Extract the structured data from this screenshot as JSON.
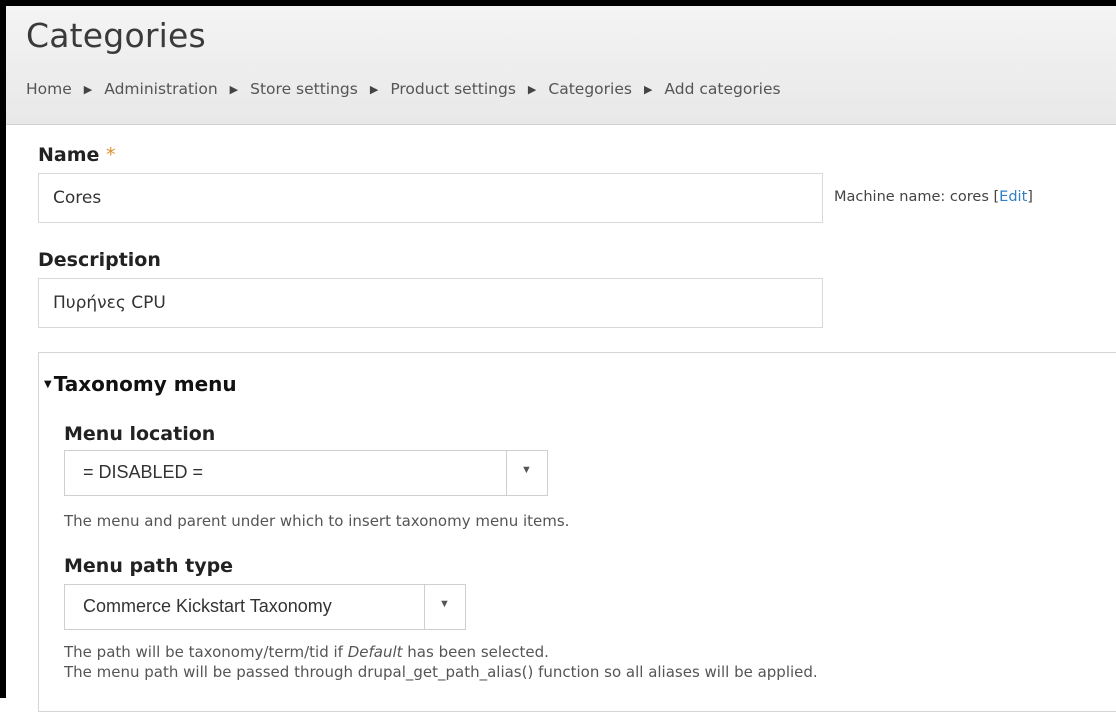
{
  "header": {
    "title": "Categories",
    "breadcrumbs": [
      "Home",
      "Administration",
      "Store settings",
      "Product settings",
      "Categories",
      "Add categories"
    ],
    "separator": "▶"
  },
  "form": {
    "name": {
      "label": "Name",
      "required_marker": "*",
      "value": "Cores",
      "machine_name_prefix": "Machine name: cores",
      "machine_name_edit": "Edit"
    },
    "description": {
      "label": "Description",
      "value": "Πυρήνες CPU"
    },
    "taxonomy_menu": {
      "legend": "Taxonomy menu",
      "collapse_icon": "triangle-down-icon",
      "menu_location": {
        "label": "Menu location",
        "selected": "= DISABLED =",
        "help": "The menu and parent under which to insert taxonomy menu items."
      },
      "menu_path_type": {
        "label": "Menu path type",
        "selected": "Commerce Kickstart Taxonomy",
        "help_line1_before": "The path will be taxonomy/term/tid if ",
        "help_line1_em": "Default",
        "help_line1_after": " has been selected.",
        "help_line2": "The menu path will be passed through drupal_get_path_alias() function so all aliases will be applied."
      }
    }
  },
  "colors": {
    "required": "#e09030",
    "link": "#2f7fc8"
  }
}
